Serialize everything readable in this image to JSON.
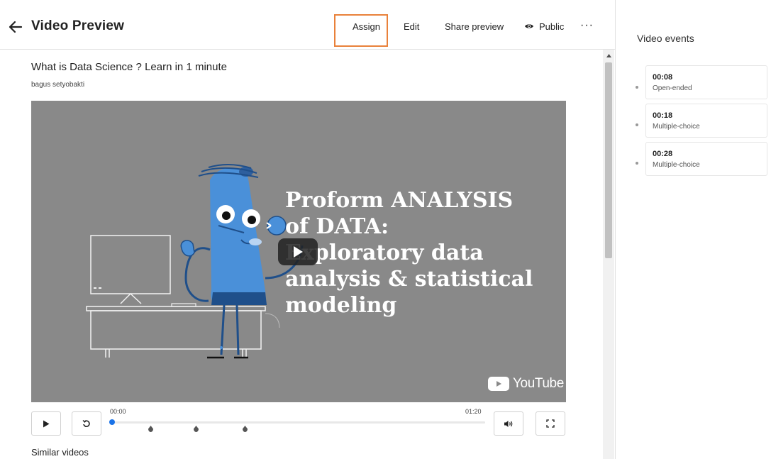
{
  "header": {
    "title": "Video Preview",
    "nav": {
      "assign": "Assign",
      "edit": "Edit",
      "share_preview": "Share preview",
      "public": "Public",
      "more": "···"
    }
  },
  "video": {
    "title": "What is Data Science ? Learn in 1 minute",
    "author": "bagus setyobakti",
    "slide_lines": [
      "Proform ANALYSIS",
      "of DATA:",
      "Exploratory data",
      "analysis & statistical",
      "modeling"
    ],
    "youtube_label": "YouTube",
    "time_current": "00:00",
    "time_total": "01:20",
    "progress": 0.0
  },
  "section": {
    "similar_videos": "Similar videos"
  },
  "sidebar": {
    "title": "Video events",
    "events": [
      {
        "time": "00:08",
        "type": "Open-ended"
      },
      {
        "time": "00:18",
        "type": "Multiple-choice"
      },
      {
        "time": "00:28",
        "type": "Multiple-choice"
      }
    ]
  },
  "icons": {
    "back": "arrow-left-icon",
    "public": "eye-icon",
    "play": "play-icon",
    "replay": "replay-icon",
    "volume": "volume-icon",
    "fullscreen": "fullscreen-icon",
    "youtube": "youtube-logo"
  },
  "colors": {
    "assign_highlight": "#e9813a",
    "progress": "#1a73e8",
    "video_bg": "#898989",
    "character": "#4a90d9"
  }
}
